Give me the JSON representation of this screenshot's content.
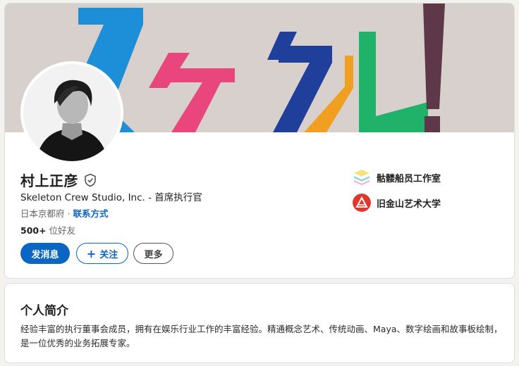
{
  "profile": {
    "name": "村上正彦",
    "headline": "Skeleton Crew Studio, Inc. - 首席执行官",
    "location": "日本京都府",
    "location_sep": " · ",
    "contact_link": "联系方式",
    "connections_count": "500+",
    "connections_label": " 位好友"
  },
  "banner": {
    "text": "スケクル!",
    "colors": [
      "#1d8fd8",
      "#e8467c",
      "#1f3f9a",
      "#f0a020",
      "#21b26a",
      "#5e3848"
    ]
  },
  "actions": {
    "message_label": "发消息",
    "follow_icon": "+",
    "follow_label": "关注",
    "more_label": "更多"
  },
  "organizations": {
    "company": {
      "label": "骷髅船员工作室",
      "icon": "stacked-layers-logo"
    },
    "school": {
      "label": "旧金山艺术大学",
      "icon": "red-circle-triangle-logo",
      "color": "#e0362c"
    }
  },
  "about": {
    "title": "个人简介",
    "body": "经验丰富的执行董事会成员，拥有在娱乐行业工作的丰富经验。精通概念艺术、传统动画、Maya、数字绘画和故事板绘制，是一位优秀的业务拓展专家。"
  },
  "theme": {
    "accent": "#0a66c2",
    "background": "#f3f2ef"
  }
}
